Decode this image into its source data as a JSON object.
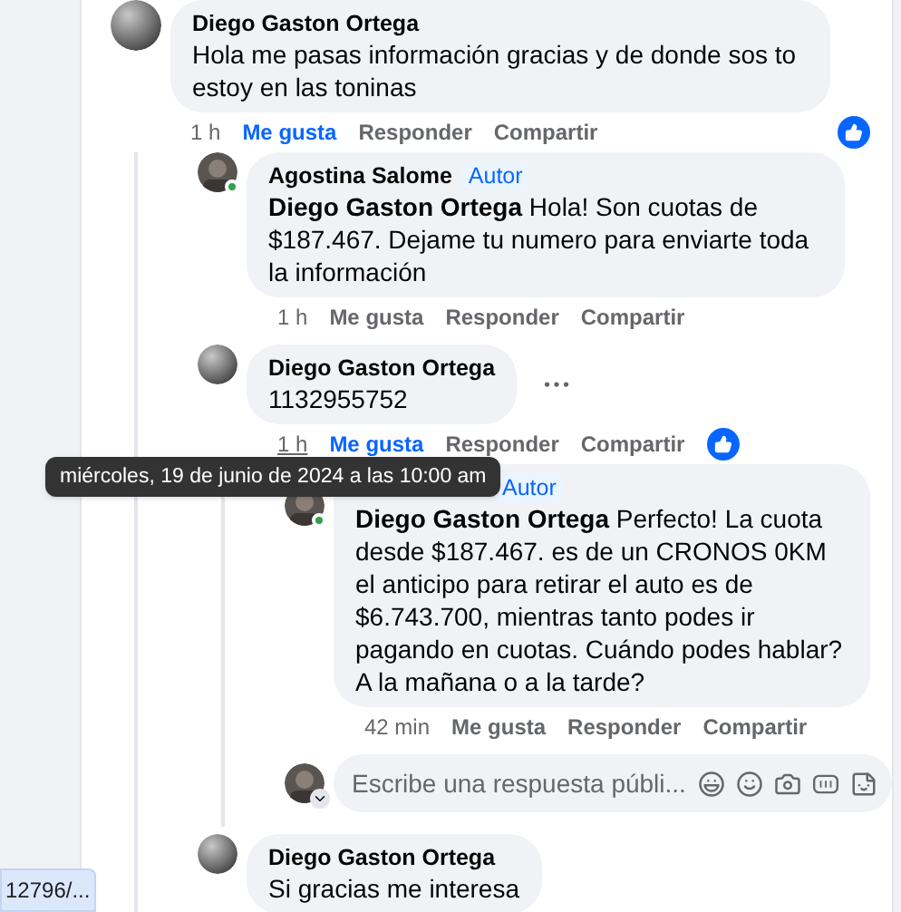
{
  "comments": [
    {
      "author": "Diego Gaston Ortega",
      "text": "Hola me pasas información gracias y de donde sos to estoy en las toninas",
      "avatar": {
        "kind": "sphere"
      },
      "online": false,
      "time": "1 h",
      "time_hovered": false,
      "liked": true,
      "like_label": "Me gusta",
      "reply_label": "Responder",
      "share_label": "Compartir",
      "reaction": true,
      "more_menu": false,
      "replies": [
        {
          "author": "Agostina Salome",
          "badge": "Autor",
          "text": "**Diego Gaston Ortega** Hola! Son cuotas de $187.467. Dejame tu numero para enviarte toda la información",
          "online": true,
          "time": "1 h",
          "time_hovered": false,
          "liked": false,
          "like_label": "Me gusta",
          "reply_label": "Responder",
          "share_label": "Compartir",
          "reaction": false,
          "more_menu": false
        },
        {
          "author": "Diego Gaston Ortega",
          "text": "1132955752",
          "avatar": {
            "kind": "sphere"
          },
          "online": false,
          "time": "1 h",
          "time_hovered": true,
          "liked": true,
          "like_label": "Me gusta",
          "reply_label": "Responder",
          "share_label": "Compartir",
          "reaction": true,
          "more_menu": true,
          "replies": [
            {
              "badge": "Autor",
              "text": "**Diego Gaston Ortega** Perfecto! La cuota desde $187.467. es de un CRONOS 0KM el anticipo para retirar el auto es de $6.743.700, mientras tanto podes ir pagando en cuotas. Cuándo podes hablar? A la mañana o a la tarde?",
              "online": true,
              "time": "42 min",
              "time_hovered": false,
              "liked": false,
              "like_label": "Me gusta",
              "reply_label": "Responder",
              "share_label": "Compartir",
              "reaction": false,
              "more_menu": false
            }
          ],
          "reply_box": {
            "placeholder": "Escribe una respuesta públi..."
          }
        },
        {
          "author": "Diego Gaston Ortega",
          "text": "Si gracias me interesa",
          "avatar": {
            "kind": "sphere"
          },
          "online": false,
          "more_menu": false
        }
      ]
    }
  ],
  "tooltip": {
    "text": "miércoles, 19 de junio de 2024 a las 10:00 am"
  },
  "status_url": "12796/..."
}
